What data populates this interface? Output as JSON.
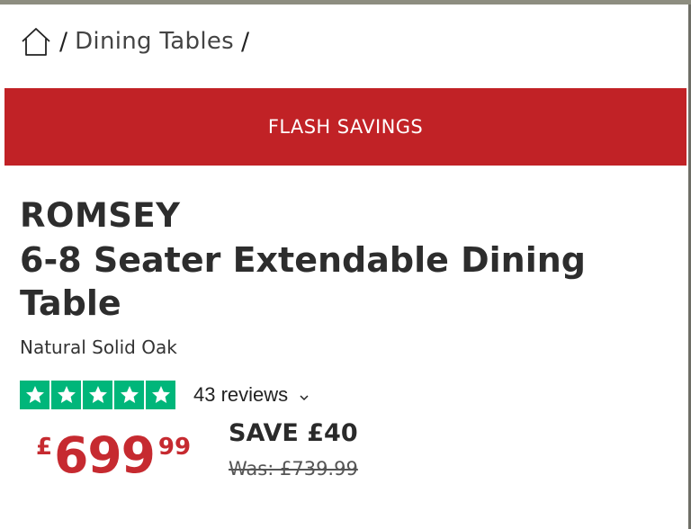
{
  "breadcrumb": {
    "home_icon": "home-icon",
    "separator": "/",
    "category": "Dining Tables"
  },
  "banner": {
    "label": "FLASH SAVINGS",
    "color": "#c12226"
  },
  "product": {
    "brand": "ROMSEY",
    "name": "6-8 Seater Extendable Dining Table",
    "variant": "Natural Solid Oak"
  },
  "rating": {
    "stars": 5,
    "star_color": "#00b67a",
    "reviews_label": "43 reviews",
    "chevron_icon": "chevron-down-icon"
  },
  "pricing": {
    "currency": "£",
    "price_whole": "699",
    "price_pence": "99",
    "save_label": "SAVE £40",
    "was_label": "Was: £739.99",
    "price_color": "#c62a30"
  }
}
